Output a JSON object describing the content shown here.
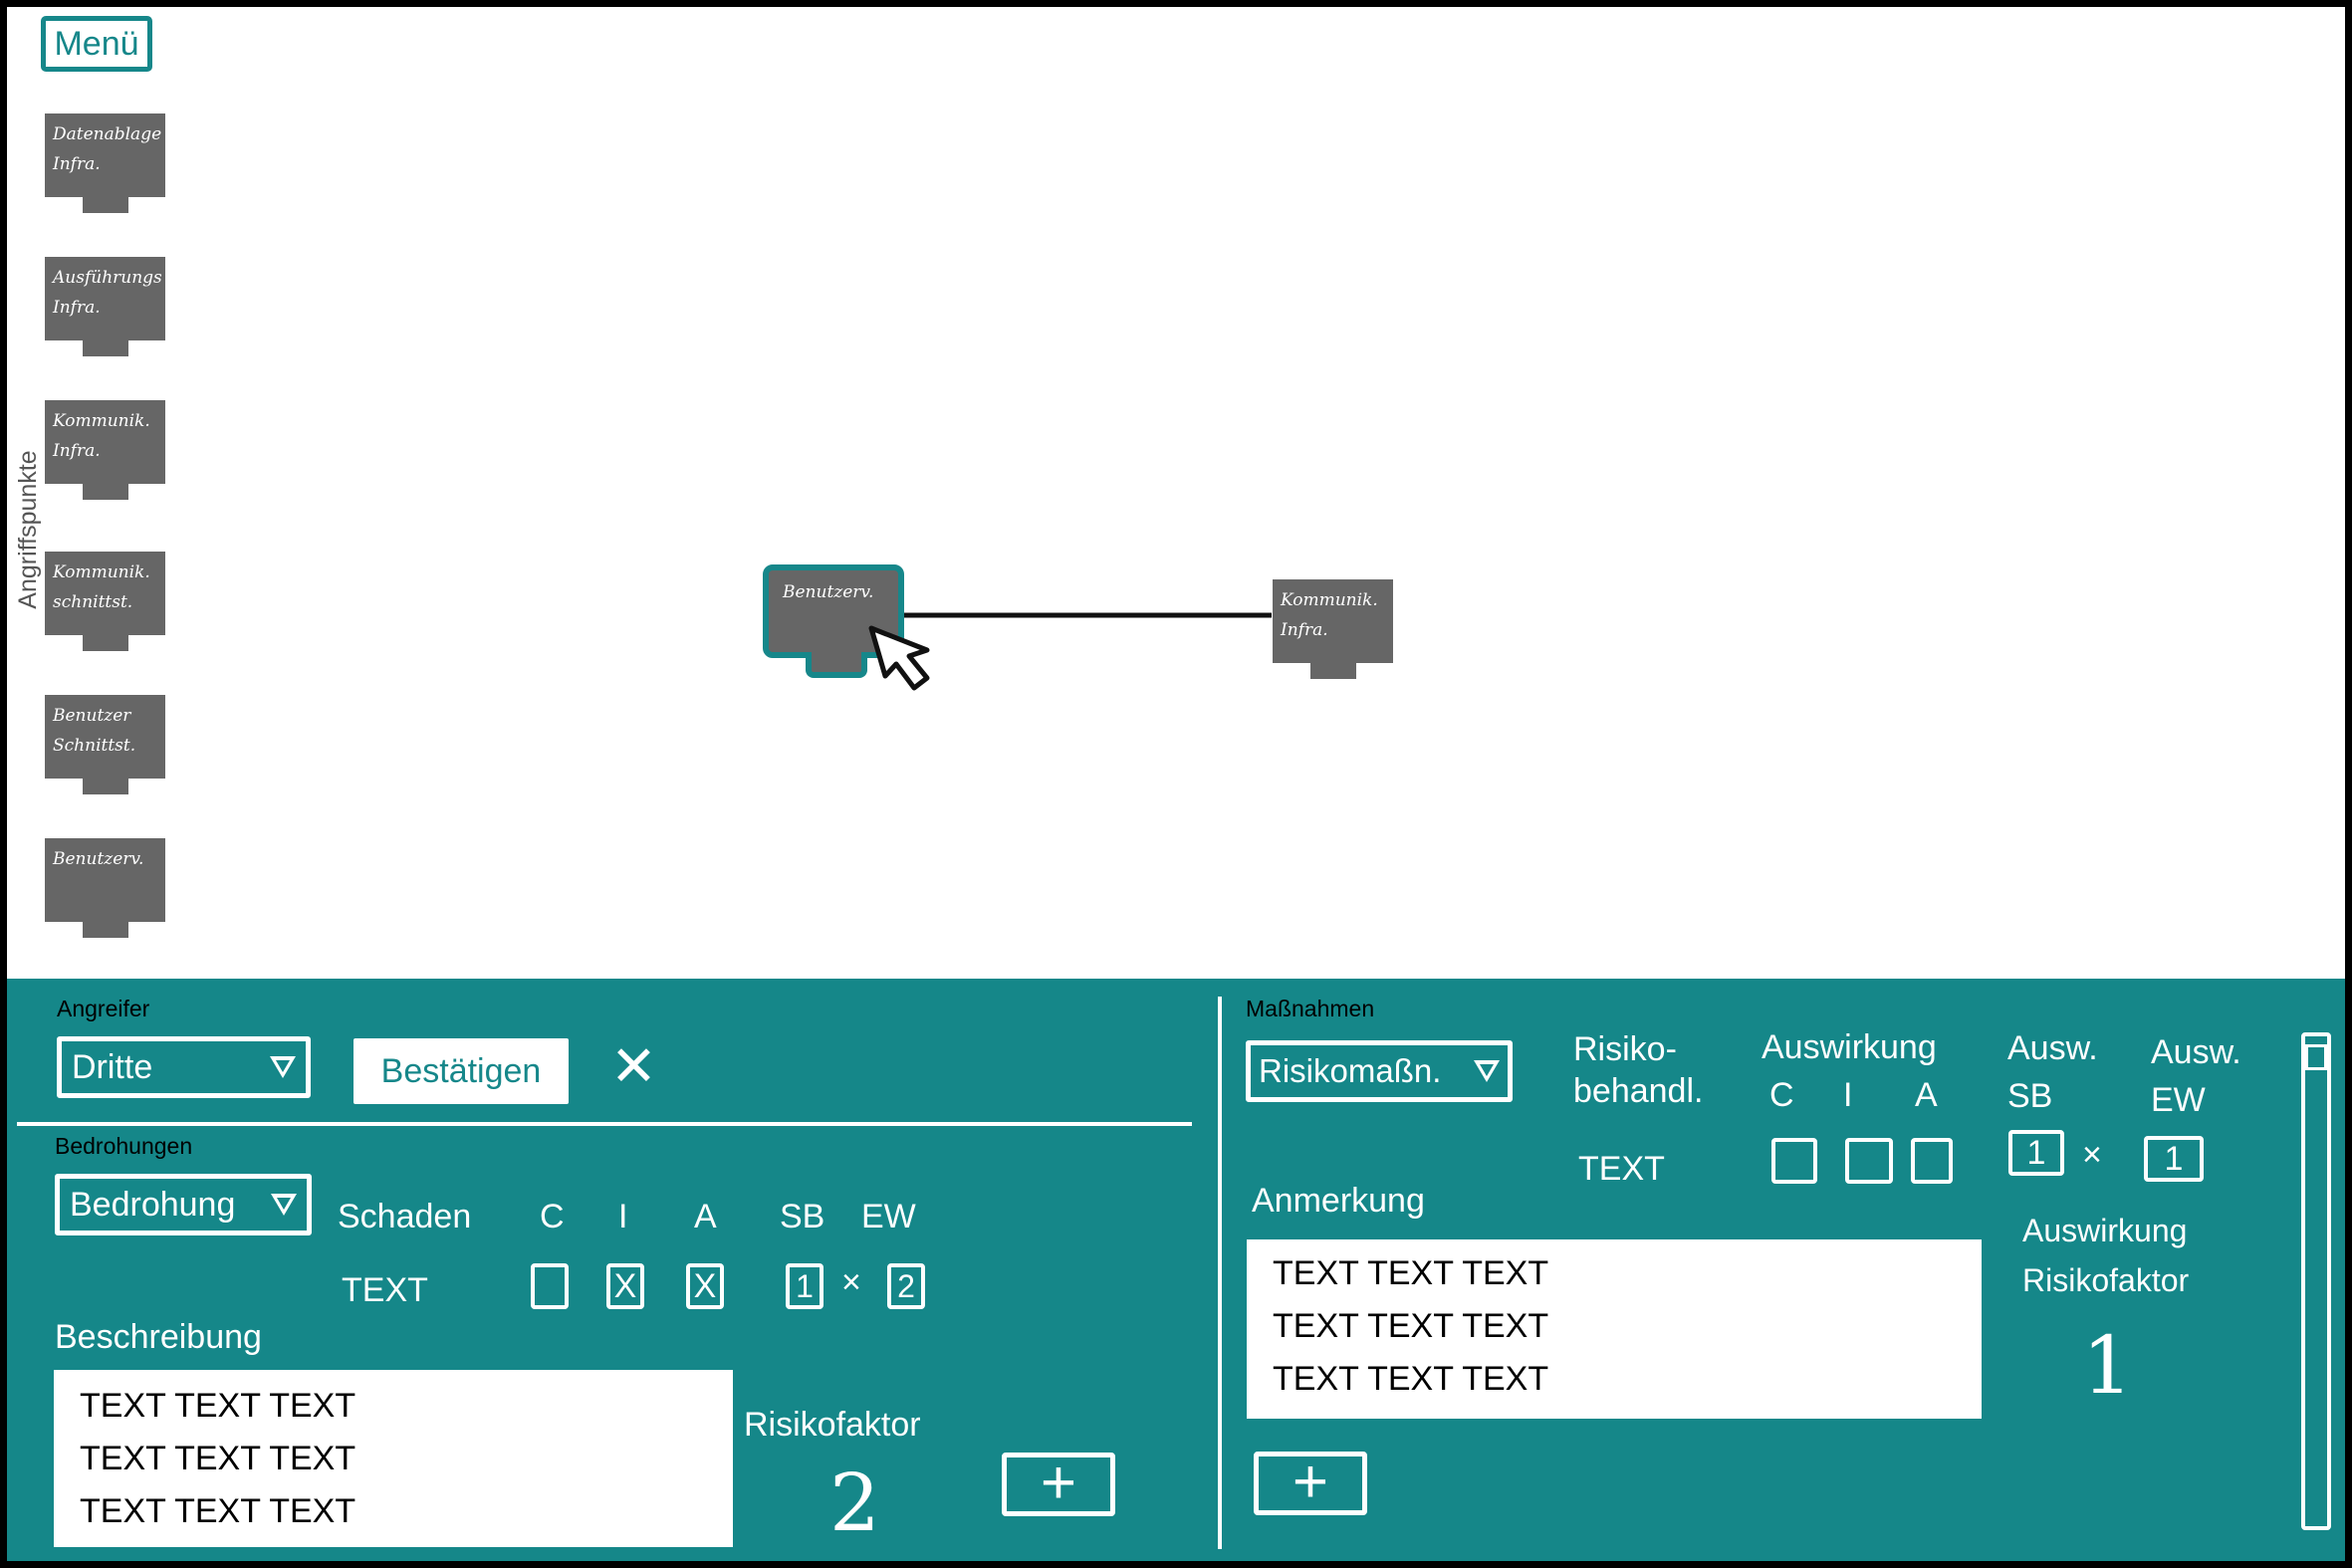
{
  "menu": {
    "label": "Menü"
  },
  "sidebar": {
    "title": "Angriffspunkte",
    "items": [
      {
        "line1": "Datenablage",
        "line2": "Infra."
      },
      {
        "line1": "Ausführungs",
        "line2": "Infra."
      },
      {
        "line1": "Kommunik.",
        "line2": "Infra."
      },
      {
        "line1": "Kommunik.",
        "line2": "schnittst."
      },
      {
        "line1": "Benutzer",
        "line2": "Schnittst."
      },
      {
        "line1": "Benutzerv.",
        "line2": ""
      }
    ]
  },
  "canvas": {
    "selected_node": {
      "label": "Benutzerv."
    },
    "target_node": {
      "line1": "Kommunik.",
      "line2": "Infra."
    }
  },
  "attacker": {
    "label": "Angreifer",
    "selected": "Dritte",
    "confirm": "Bestätigen",
    "close": "✕"
  },
  "threats": {
    "label": "Bedrohungen",
    "selected": "Bedrohung",
    "damage_label": "Schaden",
    "col_c": "C",
    "col_i": "I",
    "col_a": "A",
    "col_sb": "SB",
    "col_ew": "EW",
    "text": "TEXT",
    "check_c": "",
    "check_i": "X",
    "check_a": "X",
    "sb_value": "1",
    "times": "×",
    "ew_value": "2",
    "description_label": "Beschreibung",
    "description_lines": [
      "TEXT TEXT TEXT",
      "TEXT TEXT TEXT",
      "TEXT TEXT TEXT"
    ],
    "risk_label": "Risikofaktor",
    "risk_value": "2",
    "add": "+"
  },
  "measures": {
    "label": "Maßnahmen",
    "selected": "Risikomaßn.",
    "treatment_line1": "Risiko-",
    "treatment_line2": "behandl.",
    "impact_label": "Auswirkung",
    "col_c": "C",
    "col_i": "I",
    "col_a": "A",
    "ausw_sb_1": "Ausw.",
    "ausw_sb_2": "SB",
    "ausw_ew_1": "Ausw.",
    "ausw_ew_2": "EW",
    "text": "TEXT",
    "sb_value": "1",
    "times": "×",
    "ew_value": "1",
    "note_label": "Anmerkung",
    "note_lines": [
      "TEXT TEXT TEXT",
      "TEXT TEXT TEXT",
      "TEXT TEXT TEXT"
    ],
    "impact_risk_line1": "Auswirkung",
    "impact_risk_line2": "Risikofaktor",
    "impact_risk_value": "1",
    "add": "+"
  }
}
